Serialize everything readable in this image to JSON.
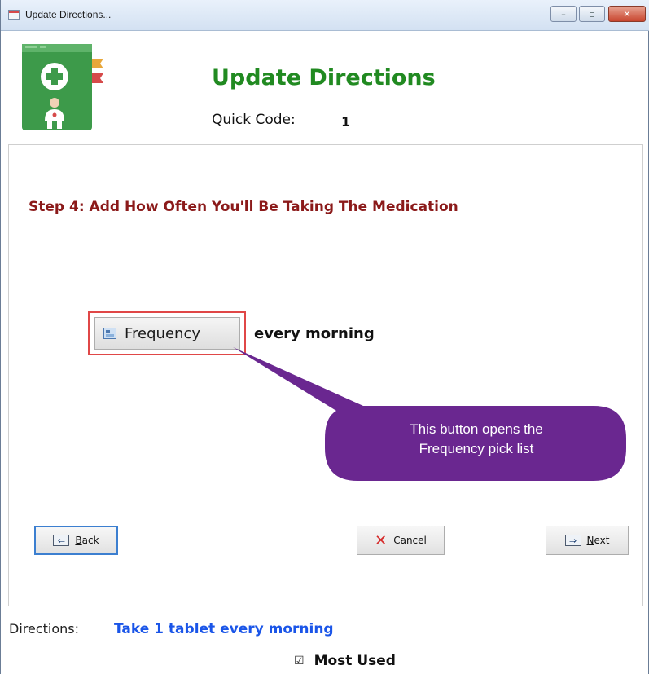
{
  "window": {
    "title": "Update Directions..."
  },
  "titlebar_buttons": {
    "minimize": "–",
    "maximize": "▫",
    "close": "✕"
  },
  "header": {
    "title": "Update Directions",
    "quick_code_label": "Quick Code:",
    "quick_code_value": "1"
  },
  "step": {
    "title": "Step 4: Add How Often You'll Be Taking The Medication"
  },
  "frequency": {
    "button_label": "Frequency",
    "value": "every morning"
  },
  "callout": {
    "line1": "This button opens the",
    "line2": "Frequency pick list"
  },
  "nav": {
    "back_icon": "⇐",
    "back_mnemonic": "B",
    "back_rest": "ack",
    "cancel_icon": "✕",
    "cancel_label": "Cancel",
    "next_icon": "⇒",
    "next_mnemonic": "N",
    "next_rest": "ext"
  },
  "footer": {
    "directions_label": "Directions:",
    "directions_value": "Take 1 tablet every morning",
    "most_used_checkbox": "☑",
    "most_used_label": "Most Used"
  },
  "colors": {
    "title_green": "#218a21",
    "step_red": "#8b1a1a",
    "directions_blue": "#1a55e8",
    "callout_purple": "#6a2790",
    "highlight_red": "#e04747"
  },
  "icons": {
    "logo": "medical-book-icon",
    "frequency": "list-icon",
    "back": "back-arrow-icon",
    "cancel": "cancel-x-icon",
    "next": "next-arrow-icon"
  }
}
